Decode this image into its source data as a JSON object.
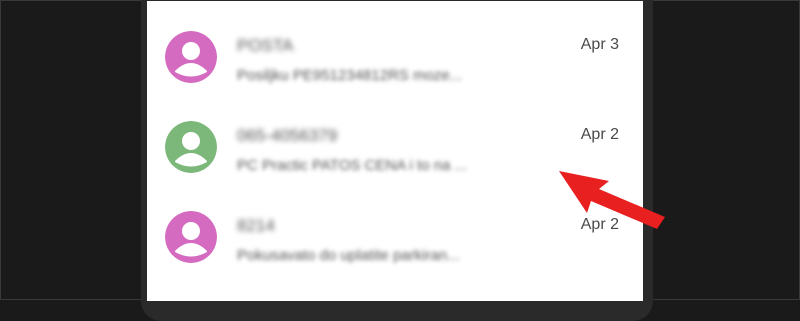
{
  "colors": {
    "pink_avatar": "#d46bc0",
    "green_avatar": "#7cb87a",
    "arrow_red": "#e82020"
  },
  "conversations": [
    {
      "sender": "POSTA",
      "date": "Apr 3",
      "preview": "Posiljku PE951234812RS moze...",
      "avatar_color": "pink",
      "avatar_icon": "person-icon"
    },
    {
      "sender": "065-4056379",
      "date": "Apr 2",
      "preview": "PC Practic PATOS CENA i to na ...",
      "avatar_color": "green",
      "avatar_icon": "person-icon"
    },
    {
      "sender": "8214",
      "date": "Apr 2",
      "preview": "Pokusavato do uplatite parkiran...",
      "avatar_color": "pink",
      "avatar_icon": "person-icon"
    }
  ],
  "annotation": {
    "icon": "red-arrow-icon",
    "points_to": "conversation 2 preview"
  }
}
